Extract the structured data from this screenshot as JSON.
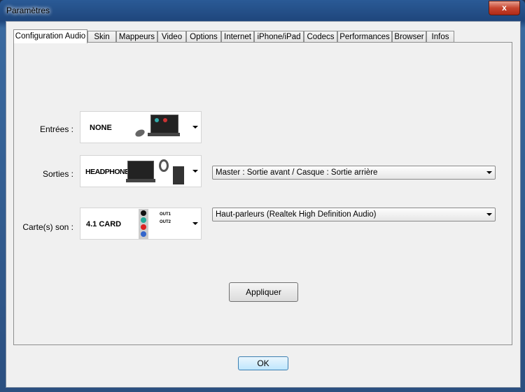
{
  "window": {
    "title": "Paramètres",
    "close_label": "x"
  },
  "tabs": [
    "Configuration Audio",
    "Skin",
    "Mappeurs",
    "Video",
    "Options",
    "Internet",
    "iPhone/iPad",
    "Codecs",
    "Performances",
    "Browser",
    "Infos"
  ],
  "audio": {
    "inputs": {
      "label": "Entrées :",
      "image_text": "NONE"
    },
    "outputs": {
      "label": "Sorties :",
      "image_text": "HEADPHONES",
      "select_value": "Master : Sortie avant / Casque : Sortie arrière"
    },
    "soundcard": {
      "label": "Carte(s) son :",
      "image_text": "4.1 CARD",
      "out1": "OUT1",
      "out2": "OUT2",
      "select_value": "Haut-parleurs (Realtek High Definition Audio)"
    },
    "apply_label": "Appliquer"
  },
  "ok_label": "OK"
}
